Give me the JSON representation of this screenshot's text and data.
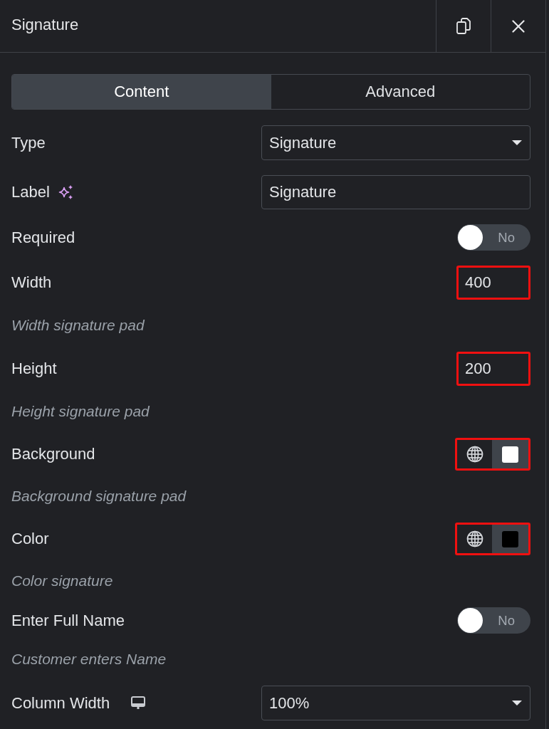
{
  "header": {
    "title": "Signature"
  },
  "tabs": [
    {
      "label": "Content",
      "selected": true
    },
    {
      "label": "Advanced",
      "selected": false
    }
  ],
  "controls": [
    {
      "kind": "select",
      "label": "Type",
      "value": "Signature"
    },
    {
      "kind": "text",
      "label": "Label",
      "value": "Signature",
      "ai": true
    },
    {
      "kind": "toggle",
      "label": "Required",
      "on": false,
      "state_text": "No"
    },
    {
      "kind": "number",
      "label": "Width",
      "value": "400",
      "highlighted": true,
      "description": "Width signature pad"
    },
    {
      "kind": "number",
      "label": "Height",
      "value": "200",
      "highlighted": true,
      "description": "Height signature pad"
    },
    {
      "kind": "color",
      "label": "Background",
      "color": "#ffffff",
      "highlighted": true,
      "description": "Background signature pad"
    },
    {
      "kind": "color",
      "label": "Color",
      "color": "#000000",
      "highlighted": true,
      "description": "Color signature"
    },
    {
      "kind": "toggle",
      "label": "Enter Full Name",
      "on": false,
      "state_text": "No",
      "description": "Customer enters Name"
    },
    {
      "kind": "select",
      "label": "Column Width",
      "value": "100%",
      "responsive": true
    }
  ]
}
